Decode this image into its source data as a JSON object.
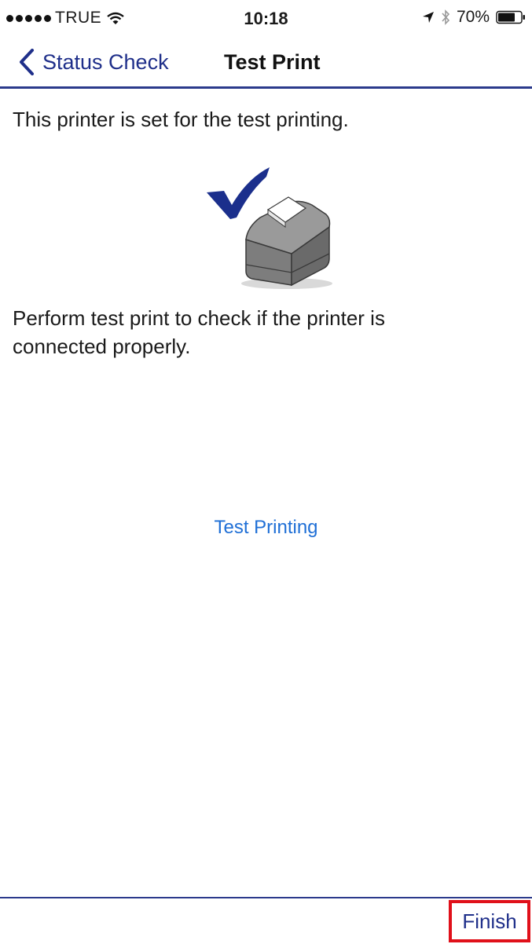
{
  "status_bar": {
    "carrier": "TRUE",
    "time": "10:18",
    "battery_percent": "70%"
  },
  "nav": {
    "back_label": "Status Check",
    "title": "Test Print"
  },
  "content": {
    "intro": "This printer is set for the test printing.",
    "instruction": "Perform test print to check if the printer is connected properly.",
    "test_button_label": "Test Printing"
  },
  "toolbar": {
    "finish_label": "Finish"
  },
  "colors": {
    "nav_accent": "#2b3a8c",
    "link_blue": "#1f6fd6",
    "checkmark_navy": "#1b2f8c",
    "highlight_red": "#e0101a"
  },
  "icons": {
    "illustration": "printer-with-checkmark",
    "back": "chevron-left-icon"
  }
}
